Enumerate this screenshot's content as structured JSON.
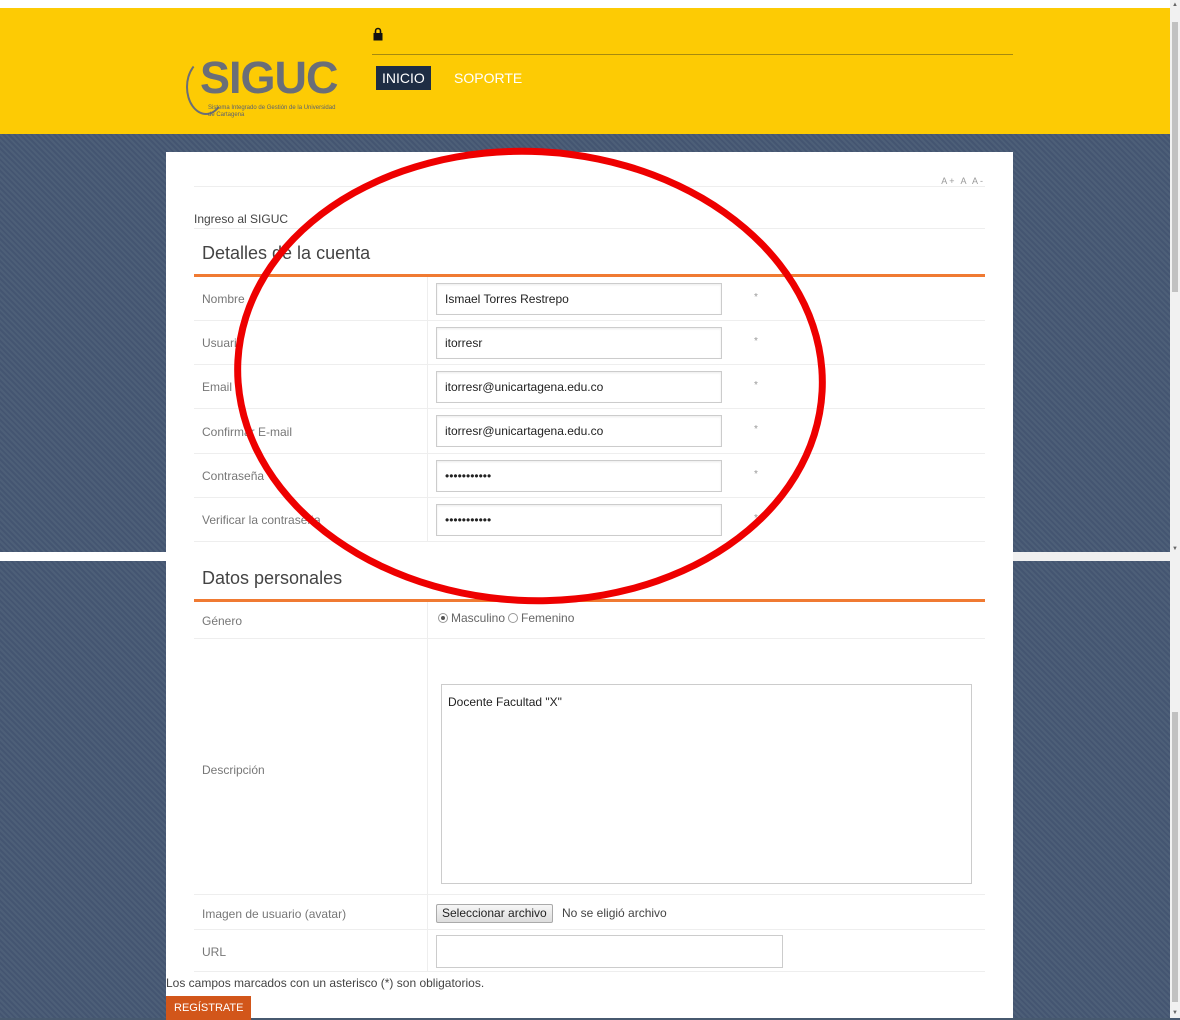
{
  "header": {
    "logo": "SIGUC",
    "logo_subtitle": "Sistema Integrado de Gestión de la Universidad de Cartagena",
    "nav": [
      "INICIO",
      "SOPORTE"
    ],
    "accent_color": "#fdcb04",
    "lock_icon": "lock-icon"
  },
  "page": {
    "font_sizer": "A+ A A-",
    "breadcrumb": "Ingreso al SIGUC"
  },
  "account": {
    "title": "Detalles de la cuenta",
    "fields": [
      {
        "label": "Nombre",
        "value": "Ismael Torres Restrepo",
        "required": "*"
      },
      {
        "label": "Usuario",
        "value": "itorresr",
        "required": "*"
      },
      {
        "label": "Email",
        "value": "itorresr@unicartagena.edu.co",
        "required": "*"
      },
      {
        "label": "Confirmar E-mail",
        "value": "itorresr@unicartagena.edu.co",
        "required": "*"
      },
      {
        "label": "Contraseña",
        "value": "•••••••••••",
        "required": "*"
      },
      {
        "label": "Verificar la contraseña",
        "value": "•••••••••••",
        "required": "*"
      }
    ]
  },
  "personal": {
    "title": "Datos personales",
    "gender": {
      "label": "Género",
      "options": [
        "Masculino",
        "Femenino"
      ],
      "selected": "Masculino"
    },
    "description": {
      "label": "Descripción",
      "value": "Docente Facultad \"X\""
    },
    "avatar": {
      "label": "Imagen de usuario (avatar)",
      "button": "Seleccionar archivo",
      "status": "No se eligió archivo"
    },
    "url": {
      "label": "URL",
      "value": ""
    }
  },
  "footer": {
    "note": "Los campos marcados con un asterisco (*) son obligatorios.",
    "submit": "REGÍSTRATE",
    "submit_color": "#d2561a"
  }
}
